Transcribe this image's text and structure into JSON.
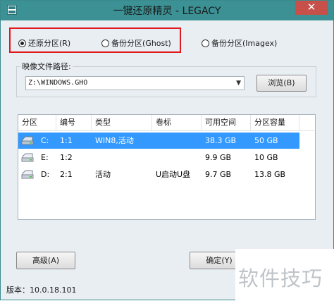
{
  "window": {
    "title": "一键还原精灵 - LEGACY",
    "close_label": "✕"
  },
  "mode": {
    "options": [
      {
        "label": "还原分区(R)",
        "checked": true
      },
      {
        "label": "备份分区(Ghost)",
        "checked": false
      },
      {
        "label": "备份分区(Imagex)",
        "checked": false
      }
    ]
  },
  "image_path": {
    "group_label": "映像文件路径:",
    "value": "Z:\\WINDOWS.GHO",
    "browse_label": "浏览(B)"
  },
  "partitions": {
    "columns": [
      "分区",
      "编号",
      "类型",
      "卷标",
      "可用空间",
      "分区容量"
    ],
    "rows": [
      {
        "drive": "C:",
        "number": "1:1",
        "type": "WIN8,活动",
        "label": "",
        "free": "38.3 GB",
        "size": "50 GB",
        "selected": true
      },
      {
        "drive": "E:",
        "number": "1:2",
        "type": "",
        "label": "",
        "free": "9.9 GB",
        "size": "10 GB",
        "selected": false
      },
      {
        "drive": "D:",
        "number": "2:1",
        "type": "活动",
        "label": "U启动U盘",
        "free": "9.7 GB",
        "size": "13.8 GB",
        "selected": false
      }
    ]
  },
  "footer": {
    "advanced_label": "高级(A)",
    "ok_label": "确定(Y)",
    "version": "版本：10.0.18.101"
  },
  "watermark": {
    "text": "软件技巧"
  },
  "colors": {
    "titlebar": "#3c9194",
    "close": "#c7504a",
    "selection": "#3399ff",
    "highlight_border": "#e0191f"
  }
}
